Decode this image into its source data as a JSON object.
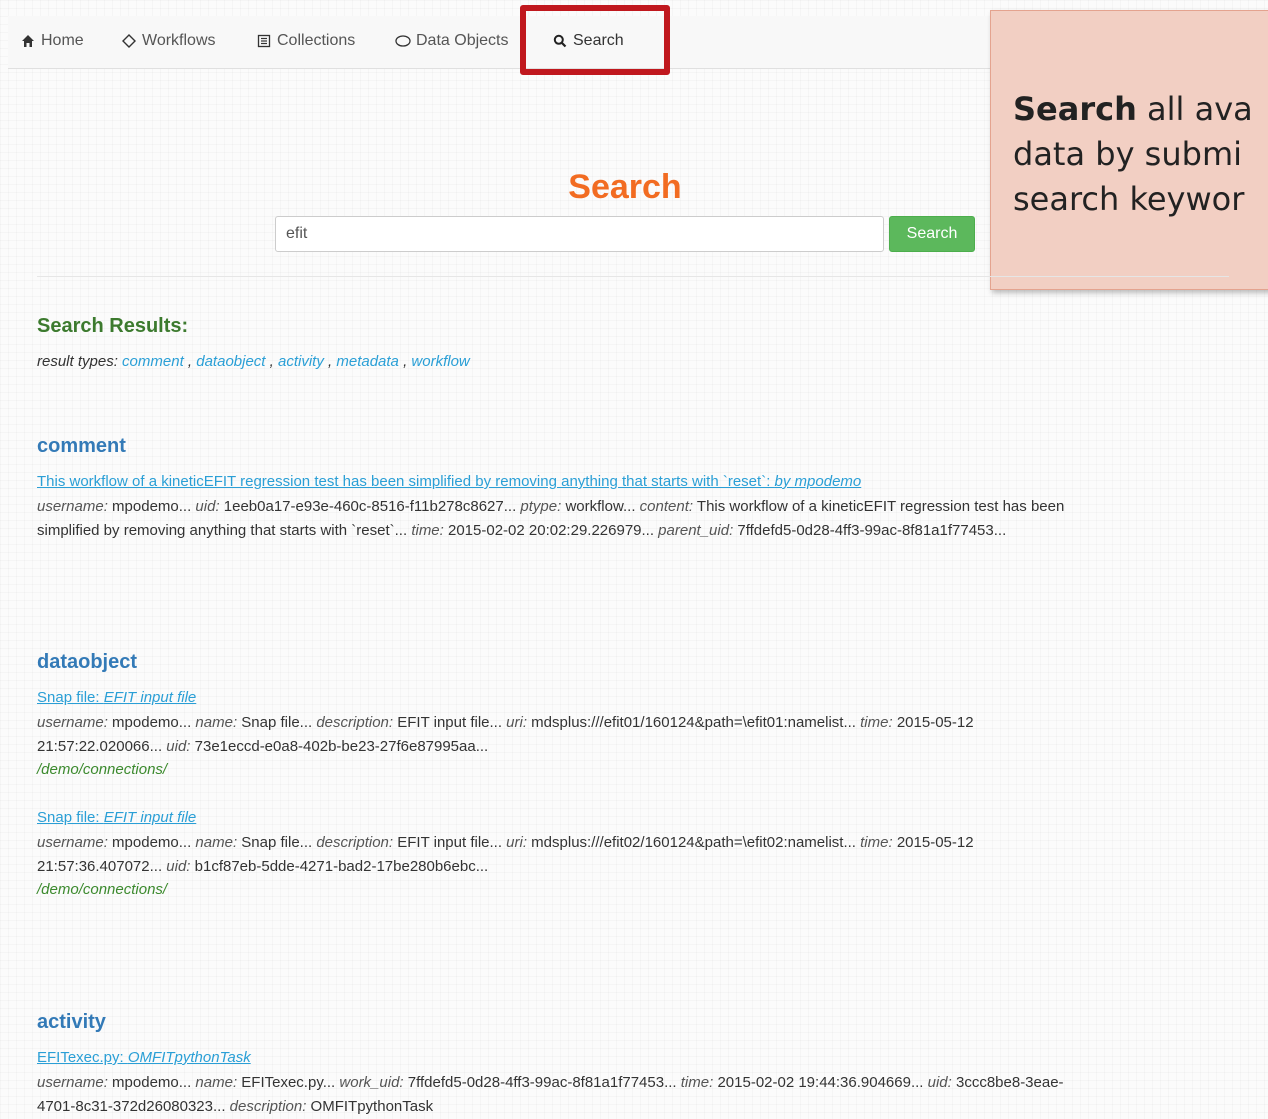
{
  "nav": {
    "items": [
      {
        "label": "Home",
        "icon": "home-icon"
      },
      {
        "label": "Workflows",
        "icon": "diamond-icon"
      },
      {
        "label": "Collections",
        "icon": "list-icon"
      },
      {
        "label": "Data Objects",
        "icon": "circle-icon"
      },
      {
        "label": "Search",
        "icon": "search-icon"
      }
    ],
    "highlight_color": "#c0181e"
  },
  "callout": {
    "bold": "Search",
    "line1": " all ava",
    "line2": "data by submi",
    "line3": "search keywor",
    "background": "#f2cfc3"
  },
  "main": {
    "title": "Search",
    "title_color": "#f26c22",
    "search_value": "efit",
    "search_button": "Search",
    "button_color": "#5cb85c",
    "results_heading": "Search Results:",
    "result_types_label": "result types:",
    "result_types": [
      "comment",
      "dataobject",
      "activity",
      "metadata",
      "workflow"
    ]
  },
  "comment": {
    "heading": "comment",
    "link_text": "This workflow of a kineticEFIT regression test has been simplified by removing anything that starts with `reset`: ",
    "link_author": "by mpodemo",
    "line1": "username: mpodemo... uid: 1eeb0a17-e93e-460c-8516-f11b278c8627... ptype: workflow... content: This workflow of a kineticEFIT regression test has been",
    "line2": "simplified by removing anything that starts with `reset`... time: 2015-02-02 20:02:29.226979... parent_uid: 7ffdefd5-0d28-4ff3-99ac-8f81a1f77453..."
  },
  "dataobject": {
    "heading": "dataobject",
    "items": [
      {
        "link_name": "Snap file: ",
        "link_desc": "EFIT input file",
        "line1": "username: mpodemo... name: Snap file... description: EFIT input file... uri: mdsplus:///efit01/160124&path=\\efit01:namelist... time: 2015-05-12",
        "line2": "21:57:22.020066... uid: 73e1eccd-e0a8-402b-be23-27f6e87995aa...",
        "path": "/demo/connections/"
      },
      {
        "link_name": "Snap file: ",
        "link_desc": "EFIT input file",
        "line1": "username: mpodemo... name: Snap file... description: EFIT input file... uri: mdsplus:///efit02/160124&path=\\efit02:namelist... time: 2015-05-12",
        "line2": "21:57:36.407072... uid: b1cf87eb-5dde-4271-bad2-17be280b6ebc...",
        "path": "/demo/connections/"
      }
    ]
  },
  "activity": {
    "heading": "activity",
    "link_name": "EFITexec.py: ",
    "link_desc": "OMFITpythonTask",
    "line1": "username: mpodemo... name: EFITexec.py... work_uid: 7ffdefd5-0d28-4ff3-99ac-8f81a1f77453... time: 2015-02-02 19:44:36.904669... uid: 3ccc8be8-3eae-",
    "line2": "4701-8c31-372d26080323... description: OMFITpythonTask"
  }
}
